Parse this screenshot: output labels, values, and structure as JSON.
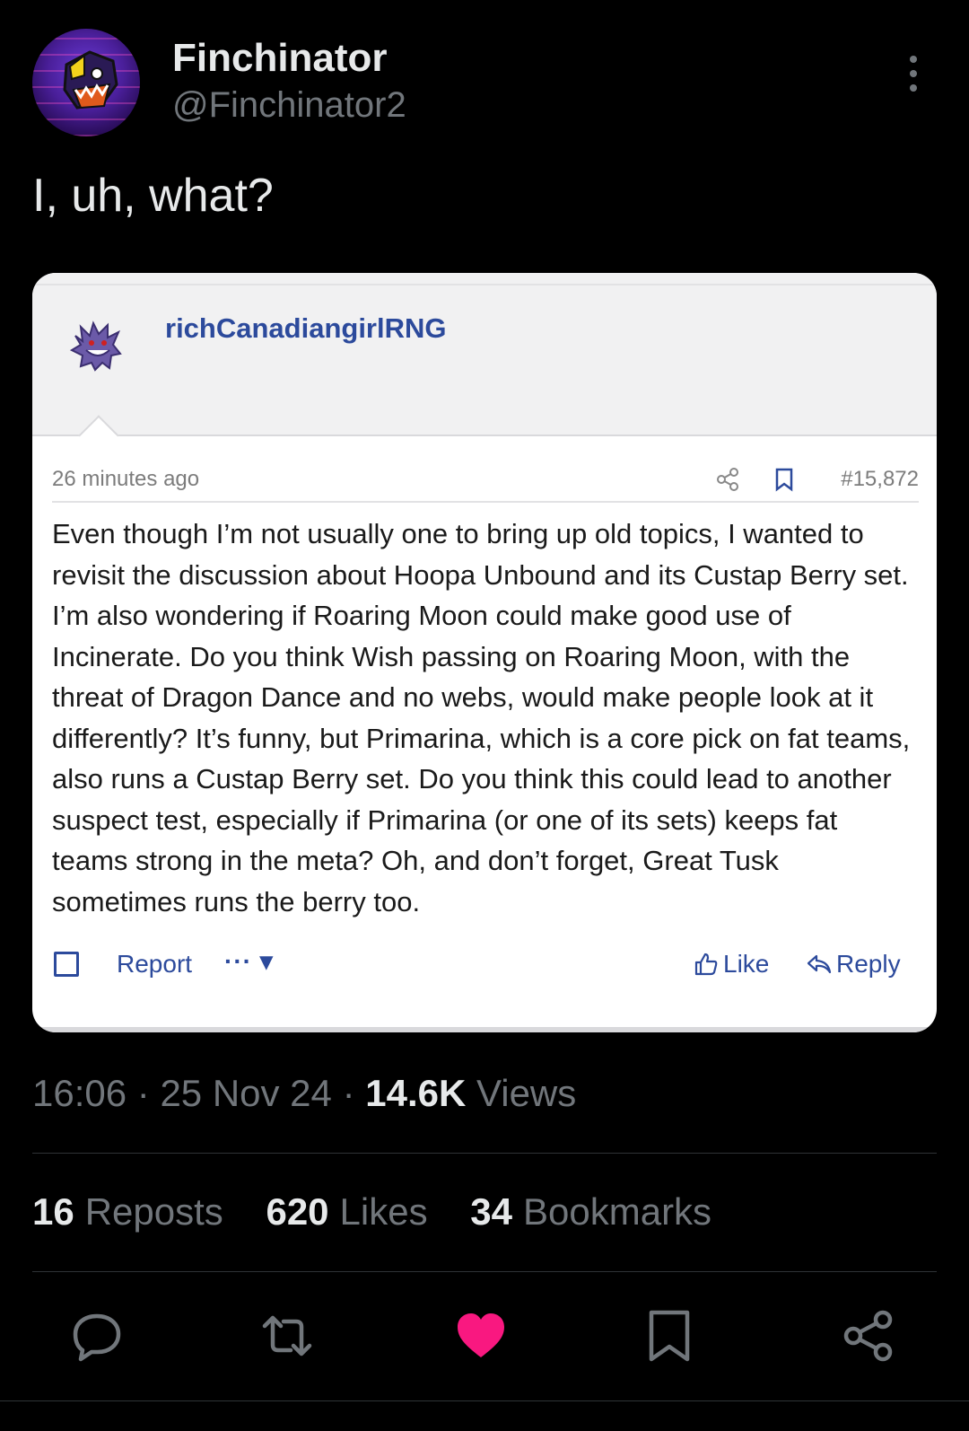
{
  "author": {
    "name": "Finchinator",
    "handle": "@Finchinator2"
  },
  "tweet_text": "I, uh, what?",
  "embedded_post": {
    "username": "richCanadiangirlRNG",
    "time_ago": "26 minutes ago",
    "post_number": "#15,872",
    "body": "Even though I’m not usually one to bring up old topics, I wanted to revisit the discussion about Hoopa Unbound and its Custap Berry set. I’m also wondering if Roaring Moon could make good use of Incinerate. Do you think Wish passing on Roaring Moon, with the threat of Dragon Dance and no webs, would make people look at it differently? It’s funny, but Primarina, which is a core pick on fat teams, also runs a Custap Berry set. Do you think this could lead to another suspect test, especially if Primarina (or one of its sets) keeps fat teams strong in the meta? Oh, and don’t forget, Great Tusk sometimes runs the berry too.",
    "report_label": "Report",
    "more_label": "··· ▾",
    "like_label": "Like",
    "reply_label": "Reply"
  },
  "meta": {
    "time": "16:06",
    "date": "25 Nov 24",
    "views_count": "14.6K",
    "views_label": "Views"
  },
  "stats": {
    "reposts_count": "16",
    "reposts_label": "Reposts",
    "likes_count": "620",
    "likes_label": "Likes",
    "bookmarks_count": "34",
    "bookmarks_label": "Bookmarks"
  },
  "colors": {
    "background": "#000000",
    "primary_text": "#e7e9ea",
    "secondary_text": "#71767b",
    "liked": "#f91880",
    "forum_link": "#2c4a9c"
  },
  "icons": [
    "more-vertical-icon",
    "reply-icon",
    "repost-icon",
    "like-icon",
    "bookmark-icon",
    "share-icon"
  ]
}
